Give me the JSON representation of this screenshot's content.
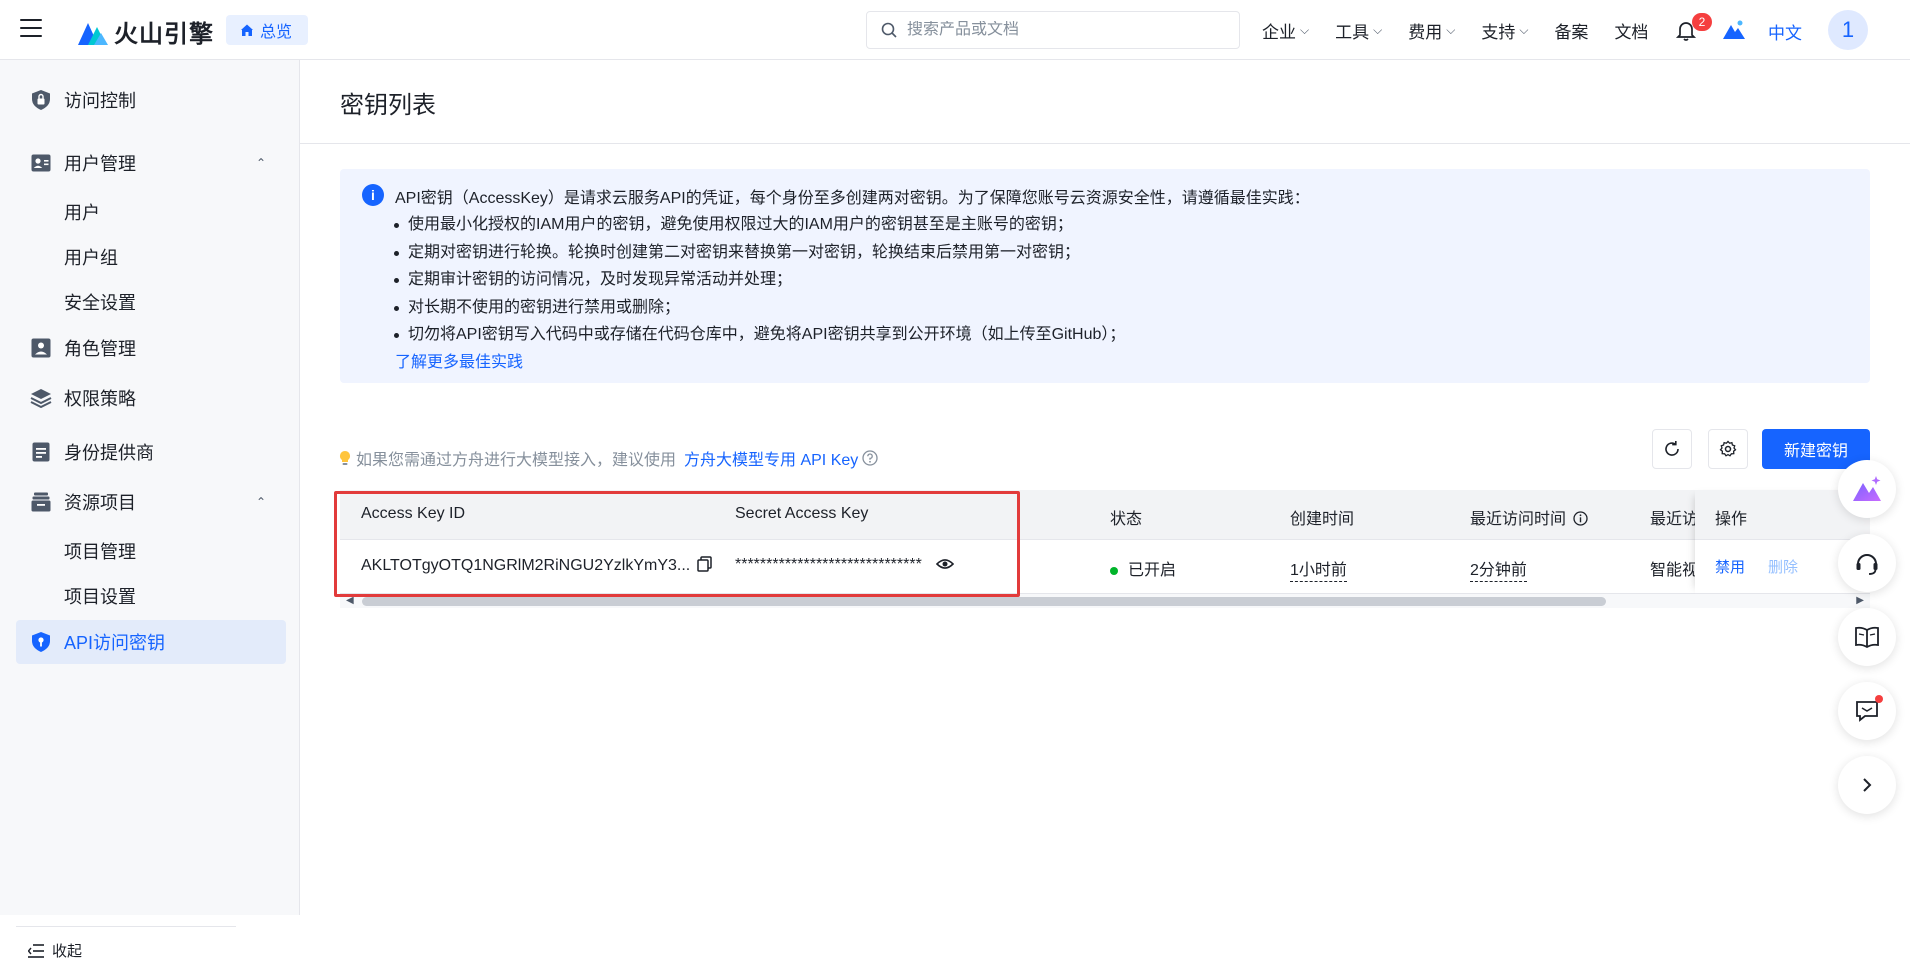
{
  "topbar": {
    "logo_text": "火山引擎",
    "overview_label": "总览",
    "search_placeholder": "搜索产品或文档",
    "nav": [
      {
        "label": "企业",
        "has_menu": true
      },
      {
        "label": "工具",
        "has_menu": true
      },
      {
        "label": "费用",
        "has_menu": true
      },
      {
        "label": "支持",
        "has_menu": true
      },
      {
        "label": "备案",
        "has_menu": false
      },
      {
        "label": "文档",
        "has_menu": false
      }
    ],
    "notification_count": "2",
    "language": "中文",
    "avatar_initial": "1"
  },
  "sidebar": {
    "title": "访问控制",
    "user_mgmt": "用户管理",
    "users": "用户",
    "user_groups": "用户组",
    "security_settings": "安全设置",
    "role_mgmt": "角色管理",
    "policies": "权限策略",
    "identity_providers": "身份提供商",
    "resource_projects": "资源项目",
    "project_mgmt": "项目管理",
    "project_settings": "项目设置",
    "api_keys": "API访问密钥",
    "collapse": "收起"
  },
  "page": {
    "title": "密钥列表"
  },
  "notice": {
    "lead": "API密钥（AccessKey）是请求云服务API的凭证，每个身份至多创建两对密钥。为了保障您账号云资源安全性，请遵循最佳实践：",
    "items": [
      "使用最小化授权的IAM用户的密钥，避免使用权限过大的IAM用户的密钥甚至是主账号的密钥；",
      "定期对密钥进行轮换。轮换时创建第二对密钥来替换第一对密钥，轮换结束后禁用第一对密钥；",
      "定期审计密钥的访问情况，及时发现异常活动并处理；",
      "对长期不使用的密钥进行禁用或删除；",
      "切勿将API密钥写入代码中或存储在代码仓库中，避免将API密钥共享到公开环境（如上传至GitHub）；"
    ],
    "link": "了解更多最佳实践"
  },
  "toolbar": {
    "tip_text": "如果您需通过方舟进行大模型接入，建议使用",
    "tip_link": "方舟大模型专用 API Key",
    "new_key_label": "新建密钥"
  },
  "table": {
    "headers": {
      "access_key_id": "Access Key ID",
      "secret_access_key": "Secret Access Key",
      "status": "状态",
      "created": "创建时间",
      "last_access": "最近访问时间",
      "last_service": "最近访",
      "actions": "操作"
    },
    "rows": [
      {
        "access_key_id": "AKLTOTgyOTQ1NGRlM2RiNGU2YzlkYmY3...",
        "secret_access_key": "******************************",
        "status": "已开启",
        "created": "1小时前",
        "last_access": "2分钟前",
        "last_service": "智能视",
        "action_disable": "禁用",
        "action_delete": "删除"
      }
    ]
  },
  "colors": {
    "primary": "#1664ff",
    "highlight": "#e23b3b",
    "status_on": "#00b42a"
  }
}
